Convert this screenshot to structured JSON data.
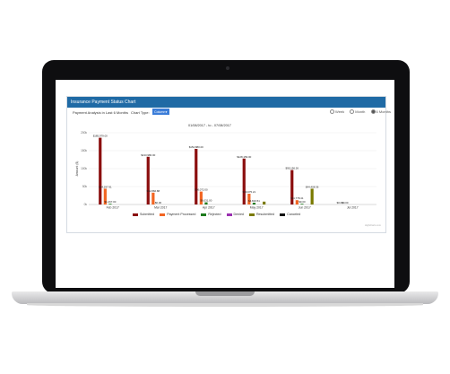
{
  "panel": {
    "title": "Insurance Payment Status Chart",
    "filter_label": "Payment Analysis in Last 6 Months",
    "chart_type_label": "Chart Type:",
    "chart_type_value": "Column",
    "ranges": [
      {
        "label": "Week",
        "selected": false
      },
      {
        "label": "Month",
        "selected": false
      },
      {
        "label": "6 Months",
        "selected": true
      }
    ],
    "date_range": "01/08/2017 - to - 07/08/2017",
    "credit": "Highcharts.com"
  },
  "chart_data": {
    "type": "bar",
    "ylabel": "Amount ($)",
    "ylim": [
      0,
      200000
    ],
    "yticks": [
      "200k",
      "150k",
      "100k",
      "50k",
      "0k"
    ],
    "categories": [
      "Feb 2017",
      "Mar 2017",
      "Apr 2017",
      "May 2017",
      "Jun 2017",
      "Jul 2017"
    ],
    "series": [
      {
        "name": "Submitted",
        "color": "#8b0e0e",
        "values": [
          186000,
          133000,
          155000,
          128000,
          96000,
          0
        ]
      },
      {
        "name": "Payment Processed",
        "color": "#f26522",
        "values": [
          44000,
          33000,
          36000,
          30000,
          12000,
          0
        ]
      },
      {
        "name": "Rejected",
        "color": "#1e7b1e",
        "values": [
          2000,
          0,
          6000,
          5000,
          2000,
          0
        ]
      },
      {
        "name": "Denied",
        "color": "#9b30b0",
        "values": [
          0,
          0,
          0,
          0,
          0,
          0
        ]
      },
      {
        "name": "Resubmitted",
        "color": "#7a7a00",
        "values": [
          0,
          0,
          0,
          8000,
          44000,
          0
        ]
      },
      {
        "name": "Canceled",
        "color": "#111111",
        "values": [
          0,
          0,
          0,
          0,
          0,
          0
        ]
      }
    ],
    "data_labels": [
      {
        "cat": 0,
        "series": 0,
        "text": "$185,979.00"
      },
      {
        "cat": 0,
        "series": 1,
        "text": "$44,297.91"
      },
      {
        "cat": 0,
        "series": 2,
        "text": "$1,267.00"
      },
      {
        "cat": 1,
        "series": 0,
        "text": "$133,980.00"
      },
      {
        "cat": 1,
        "series": 1,
        "text": "$32,866.88"
      },
      {
        "cat": 1,
        "series": 2,
        "text": "$0.00"
      },
      {
        "cat": 2,
        "series": 0,
        "text": "$154,880.00"
      },
      {
        "cat": 2,
        "series": 1,
        "text": "$36,072.00"
      },
      {
        "cat": 2,
        "series": 2,
        "text": "$6,031.00"
      },
      {
        "cat": 3,
        "series": 0,
        "text": "$128,159.00"
      },
      {
        "cat": 3,
        "series": 1,
        "text": "$30,075.21"
      },
      {
        "cat": 3,
        "series": 2,
        "text": "$4,816.51"
      },
      {
        "cat": 4,
        "series": 0,
        "text": "$95,156.26"
      },
      {
        "cat": 4,
        "series": 1,
        "text": "$11,778.41"
      },
      {
        "cat": 4,
        "series": 4,
        "text": "$44,408.36"
      },
      {
        "cat": 4,
        "series": 2,
        "text": "$0.00"
      },
      {
        "cat": 5,
        "series": 0,
        "text": "$0.00"
      },
      {
        "cat": 5,
        "series": 1,
        "text": "$0.00"
      }
    ]
  }
}
